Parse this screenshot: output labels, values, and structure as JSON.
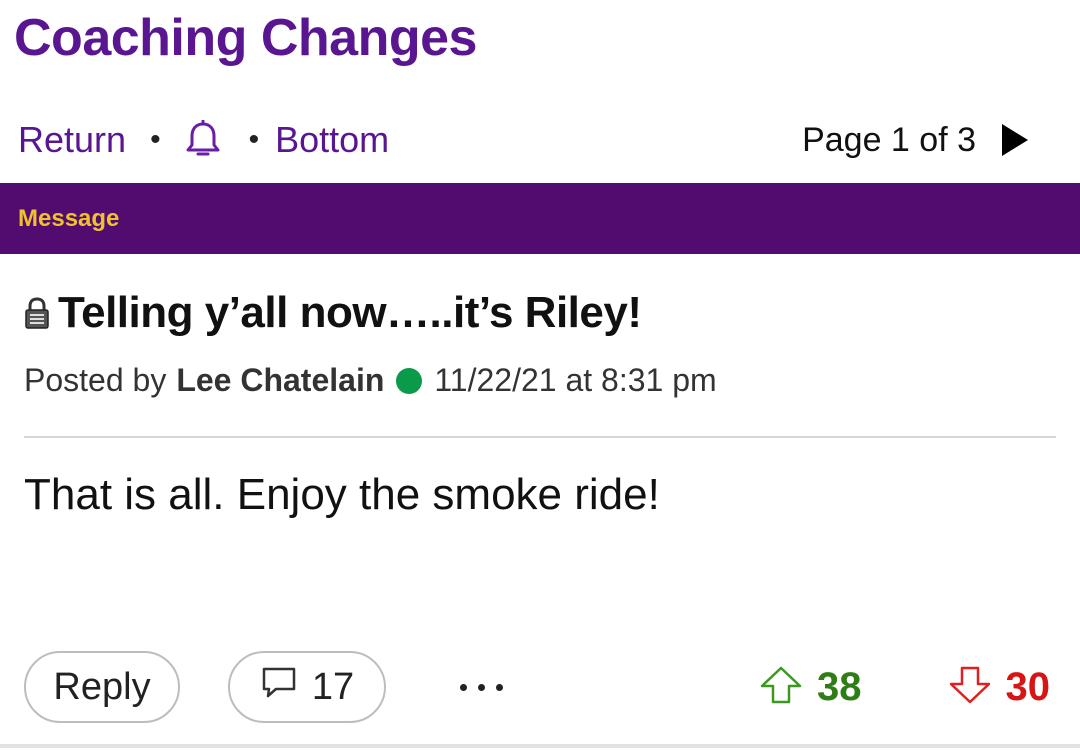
{
  "forum": {
    "title": "Coaching Changes"
  },
  "nav": {
    "return_label": "Return",
    "separator": "•",
    "bell_icon": "bell-icon",
    "bottom_label": "Bottom",
    "page_label": "Page 1 of 3",
    "next_icon": "play-arrow-icon"
  },
  "section": {
    "label": "Message"
  },
  "post": {
    "lock_icon": "lock-icon",
    "title": "Telling y’all now…..it’s Riley!",
    "posted_by_label": "Posted by",
    "author": "Lee Chatelain",
    "online_status": "online",
    "timestamp": "11/22/21 at 8:31 pm",
    "body": "That is all. Enjoy the smoke ride!"
  },
  "actions": {
    "reply_label": "Reply",
    "comment_icon": "comment-icon",
    "comment_count": "17",
    "more_icon": "more-icon",
    "upvote_count": "38",
    "downvote_count": "30"
  },
  "colors": {
    "brand_purple": "#520b6e",
    "link_purple": "#5a1590",
    "section_gold": "#f0c12e",
    "online_green": "#0a9a4a",
    "upvote_green": "#2f7d16",
    "downvote_red": "#d61515"
  }
}
